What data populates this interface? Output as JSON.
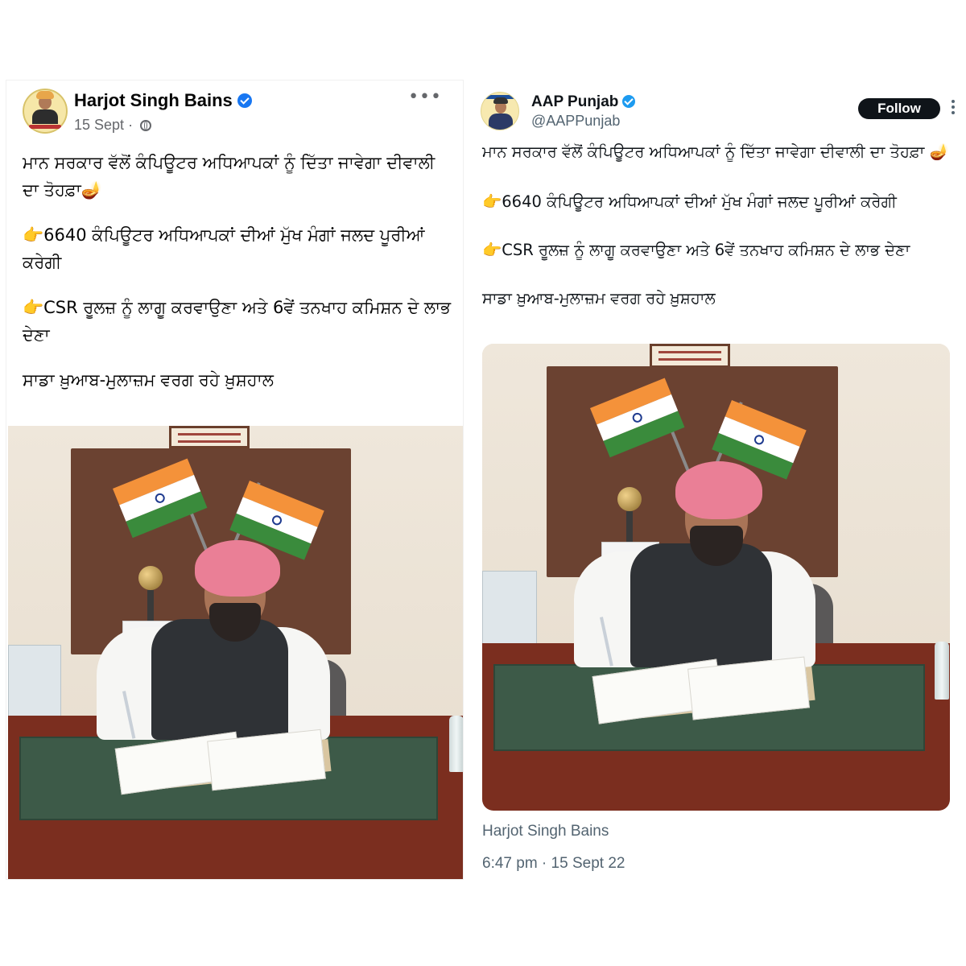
{
  "left_post": {
    "author": "Harjot Singh Bains",
    "date": "15 Sept",
    "separator": "·",
    "more": "•••",
    "lines": [
      "ਮਾਨ ਸਰਕਾਰ ਵੱਲੋਂ ਕੰਪਿਊਟਰ ਅਧਿਆਪਕਾਂ ਨੂੰ ਦਿੱਤਾ ਜਾਵੇਗਾ ਦੀਵਾਲੀ ਦਾ ਤੋਹਫ਼ਾ🪔",
      "👉6640 ਕੰਪਿਊਟਰ ਅਧਿਆਪਕਾਂ ਦੀਆਂ ਮੁੱਖ ਮੰਗਾਂ ਜਲਦ ਪੂਰੀਆਂ ਕਰੇਗੀ",
      "👉CSR ਰੂਲਜ਼ ਨੂੰ ਲਾਗੂ ਕਰਵਾਉਣਾ ਅਤੇ 6ਵੇਂ ਤਨਖਾਹ ਕਮਿਸ਼ਨ ਦੇ ਲਾਭ ਦੇਣਾ",
      "ਸਾਡਾ ਖ਼ੁਆਬ-ਮੁਲਾਜ਼ਮ ਵਰਗ ਰਹੇ ਖ਼ੁਸ਼ਹਾਲ"
    ]
  },
  "right_post": {
    "author": "AAP Punjab",
    "handle": "@AAPPunjab",
    "follow_label": "Follow",
    "lines": [
      "ਮਾਨ ਸਰਕਾਰ ਵੱਲੋਂ ਕੰਪਿਊਟਰ ਅਧਿਆਪਕਾਂ ਨੂੰ ਦਿੱਤਾ ਜਾਵੇਗਾ ਦੀਵਾਲੀ ਦਾ ਤੋਹਫ਼ਾ 🪔",
      "👉6640 ਕੰਪਿਊਟਰ ਅਧਿਆਪਕਾਂ ਦੀਆਂ ਮੁੱਖ ਮੰਗਾਂ ਜਲਦ ਪੂਰੀਆਂ ਕਰੇਗੀ",
      "👉CSR ਰੂਲਜ਼ ਨੂੰ ਲਾਗੂ ਕਰਵਾਉਣਾ ਅਤੇ 6ਵੇਂ ਤਨਖਾਹ ਕਮਿਸ਼ਨ ਦੇ ਲਾਭ ਦੇਣਾ",
      "ਸਾਡਾ ਖ਼ੁਆਬ-ਮੁਲਾਜ਼ਮ ਵਰਗ ਰਹੇ ਖ਼ੁਸ਼ਹਾਲ"
    ],
    "photo_caption": "Harjot Singh Bains",
    "timestamp": "6:47 pm · 15 Sept 22"
  },
  "colors": {
    "fb_verified": "#1877f2",
    "tw_verified": "#1d9bf0",
    "follow_bg": "#0f1419",
    "turban": "#ea7f96",
    "desk": "#7b2e1f",
    "desk_mat": "#3d5a48"
  },
  "icons": [
    "verified-badge-icon",
    "globe-icon",
    "more-options-icon"
  ]
}
